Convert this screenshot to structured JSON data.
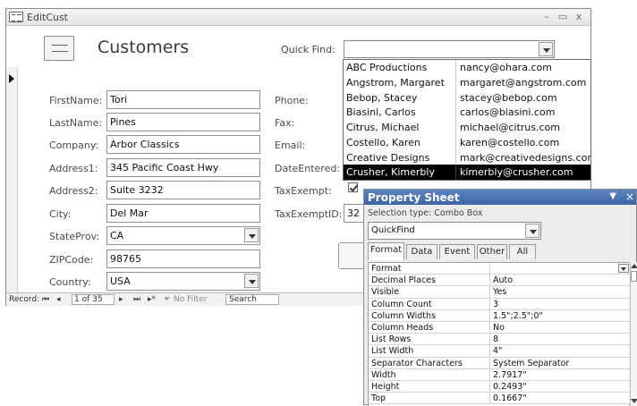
{
  "window": {
    "title": "EditCust",
    "min_glyph": "–",
    "max_glyph": "▭",
    "close_glyph": "x"
  },
  "header": {
    "title": "Customers",
    "quick_find_label": "Quick Find:",
    "quick_find_value": ""
  },
  "fields": {
    "first_name": {
      "label": "FirstName:",
      "value": "Tori"
    },
    "last_name": {
      "label": "LastName:",
      "value": "Pines"
    },
    "company": {
      "label": "Company:",
      "value": "Arbor Classics"
    },
    "address1": {
      "label": "Address1:",
      "value": "345 Pacific Coast Hwy"
    },
    "address2": {
      "label": "Address2:",
      "value": "Suite 3232"
    },
    "city": {
      "label": "City:",
      "value": "Del Mar"
    },
    "state_prov": {
      "label": "StateProv:",
      "value": "CA"
    },
    "zip_code": {
      "label": "ZIPCode:",
      "value": "98765"
    },
    "country": {
      "label": "Country:",
      "value": "USA"
    },
    "phone": {
      "label": "Phone:",
      "value": ""
    },
    "fax": {
      "label": "Fax:",
      "value": ""
    },
    "email": {
      "label": "Email:",
      "value": ""
    },
    "date_entered": {
      "label": "DateEntered:",
      "value": ""
    },
    "tax_exempt": {
      "label": "TaxExempt:",
      "checked": true
    },
    "tax_exempt_id": {
      "label": "TaxExemptID:",
      "value": "32"
    }
  },
  "navigation": {
    "record_label": "Record:",
    "first_glyph": "⏮",
    "prev_glyph": "◂",
    "position": "1 of 35",
    "next_glyph": "▸",
    "last_glyph": "⏭",
    "new_glyph": "▸*",
    "filter_label": "No Filter",
    "search_label": "Search"
  },
  "quick_find_list": [
    {
      "name": "ABC Productions",
      "email": "nancy@ohara.com"
    },
    {
      "name": "Angstrom, Margaret",
      "email": "margaret@angstrom.com"
    },
    {
      "name": "Bebop, Stacey",
      "email": "stacey@bebop.com"
    },
    {
      "name": "Biasini, Carlos",
      "email": "carlos@biasini.com"
    },
    {
      "name": "Citrus, Michael",
      "email": "michael@citrus.com"
    },
    {
      "name": "Costello, Karen",
      "email": "karen@costello.com"
    },
    {
      "name": "Creative Designs",
      "email": "mark@creativedesigns.com"
    },
    {
      "name": "Crusher, Kimerbly",
      "email": "kimerbly@crusher.com",
      "selected": true
    }
  ],
  "property_sheet": {
    "title": "Property Sheet",
    "selection_type": "Selection type:  Combo Box",
    "object": "QuickFind",
    "tabs": [
      "Format",
      "Data",
      "Event",
      "Other",
      "All"
    ],
    "active_tab": "Format",
    "rows": [
      {
        "name": "Format",
        "value": ""
      },
      {
        "name": "Decimal Places",
        "value": "Auto"
      },
      {
        "name": "Visible",
        "value": "Yes"
      },
      {
        "name": "Column Count",
        "value": "3"
      },
      {
        "name": "Column Widths",
        "value": "1.5\";2.5\";0\""
      },
      {
        "name": "Column Heads",
        "value": "No"
      },
      {
        "name": "List Rows",
        "value": "8"
      },
      {
        "name": "List Width",
        "value": "4\""
      },
      {
        "name": "Separator Characters",
        "value": "System Separator"
      },
      {
        "name": "Width",
        "value": "2.7917\""
      },
      {
        "name": "Height",
        "value": "0.2493\""
      },
      {
        "name": "Top",
        "value": "0.1667\""
      }
    ]
  }
}
